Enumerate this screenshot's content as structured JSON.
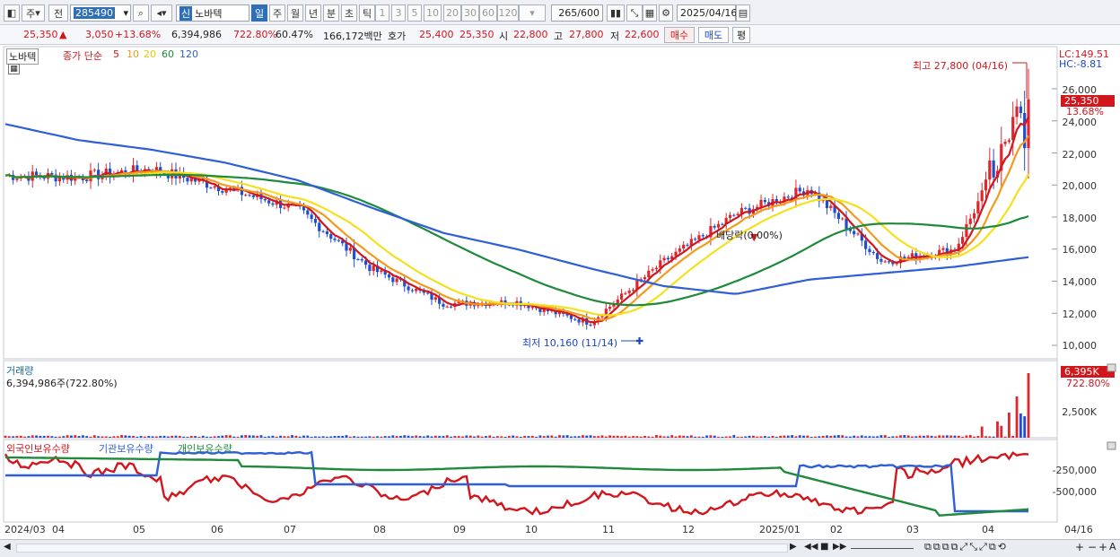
{
  "toolbar": {
    "period_1": "주",
    "period_2": "전",
    "stock_code": "285490",
    "market_badge": "신",
    "stock_name": "노바텍",
    "tabs": [
      "일",
      "주",
      "월",
      "년",
      "분",
      "초",
      "틱"
    ],
    "tab_selected": "일",
    "intervals": [
      "1",
      "3",
      "5",
      "10",
      "20",
      "30",
      "60",
      "120"
    ],
    "count_value": "265",
    "count_total": "/600",
    "date_value": "2025/04/16"
  },
  "quote": {
    "price": "25,350",
    "change_arrow": "▲",
    "change": "3,050",
    "change_pct": "+13.68%",
    "volume": "6,394,986",
    "volume_ratio": "722.80%",
    "turnover": "60.47%",
    "amount": "166,172백만",
    "bid_label": "호가",
    "ask_price": "25,400",
    "bid_price": "25,350",
    "open_label": "시",
    "open": "22,800",
    "high_label": "고",
    "high": "27,800",
    "low_label": "저",
    "low": "22,600",
    "buy_button": "매수",
    "sell_button": "매도",
    "eval_button": "평"
  },
  "price_panel": {
    "stock_name": "노바텍",
    "legend_prefix": "종가 단순",
    "ma_periods": [
      "5",
      "10",
      "20",
      "60",
      "120"
    ],
    "ma_colors": [
      "#d1161d",
      "#f39a1c",
      "#f3e11e",
      "#1f8a3b",
      "#2e5fd6"
    ],
    "lc": "LC:149.51",
    "hc": "HC:-8.81",
    "high_note": "최고 27,800 (04/16)",
    "low_note": "최저 10,160 (11/14)",
    "dividend_note": "배당락(0.00%)",
    "last_price_tag": "25,350",
    "last_pct_tag": "13.68%",
    "y_ticks": [
      "26,000",
      "24,000",
      "22,000",
      "20,000",
      "18,000",
      "16,000",
      "14,000",
      "12,000",
      "10,000"
    ]
  },
  "volume_panel": {
    "title": "거래량",
    "value": "6,394,986주(722.80%)",
    "tag_value": "6,395K",
    "tag_pct": "722.80%",
    "y_tick": "2,500K"
  },
  "holder_panel": {
    "legend": [
      "외국인보유수량",
      "기관보유수량",
      "개인보유수량"
    ],
    "colors": [
      "#d1161d",
      "#2e5fd6",
      "#1f8a3b"
    ],
    "y_ticks": [
      "-250,000",
      "-500,000"
    ]
  },
  "x_axis": [
    "2024/03",
    "04",
    "05",
    "06",
    "07",
    "08",
    "09",
    "10",
    "11",
    "12",
    "2025/01",
    "02",
    "03",
    "04",
    "04/16"
  ],
  "chart_data": {
    "type": "line",
    "title": "노바텍",
    "x": [
      "2024/03",
      "04",
      "05",
      "06",
      "07",
      "08",
      "09",
      "10",
      "11",
      "12",
      "2025/01",
      "02",
      "03",
      "04",
      "04/16"
    ],
    "series": [
      {
        "name": "종가",
        "values": [
          20600,
          20500,
          21000,
          19800,
          18500,
          14800,
          12600,
          12700,
          11400,
          15200,
          18200,
          19800,
          15200,
          16000,
          25350
        ]
      },
      {
        "name": "120",
        "values": [
          23800,
          22800,
          22200,
          21400,
          20300,
          18600,
          17000,
          16000,
          14800,
          13700,
          13200,
          14100,
          14500,
          14900,
          15500
        ]
      }
    ],
    "high": {
      "value": 27800,
      "date": "04/16"
    },
    "low": {
      "value": 10160,
      "date": "11/14"
    },
    "ylim": [
      10000,
      27800
    ]
  }
}
